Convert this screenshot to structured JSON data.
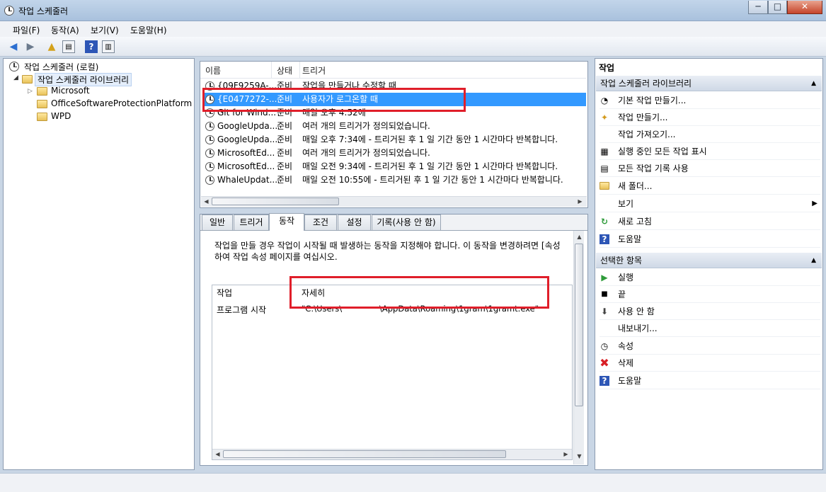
{
  "window": {
    "title": "작업 스케줄러",
    "min": "─",
    "max": "□",
    "close": "✕"
  },
  "menu": [
    "파일(F)",
    "동작(A)",
    "보기(V)",
    "도움말(H)"
  ],
  "tree": {
    "root": "작업 스케줄러 (로컬)",
    "library": "작업 스케줄러 라이브러리",
    "folders": [
      "Microsoft",
      "OfficeSoftwareProtectionPlatform",
      "WPD"
    ]
  },
  "task_table": {
    "columns": [
      "이름",
      "상태",
      "트리거"
    ],
    "rows": [
      {
        "name": "{09F9259A-...",
        "status": "준비",
        "trigger": "작업을 만들거나 수정할 때"
      },
      {
        "name": "{E0477272-...",
        "status": "준비",
        "trigger": "사용자가 로그온할 때"
      },
      {
        "name": "Git for Wind...",
        "status": "준비",
        "trigger": "매일 오후 4:52에"
      },
      {
        "name": "GoogleUpda...",
        "status": "준비",
        "trigger": "여러 개의 트리거가 정의되었습니다."
      },
      {
        "name": "GoogleUpda...",
        "status": "준비",
        "trigger": "매일 오후 7:34에 - 트리거된 후 1 일 기간 동안 1 시간마다 반복합니다."
      },
      {
        "name": "MicrosoftEd...",
        "status": "준비",
        "trigger": "여러 개의 트리거가 정의되었습니다."
      },
      {
        "name": "MicrosoftEd...",
        "status": "준비",
        "trigger": "매일 오전 9:34에 - 트리거된 후 1 일 기간 동안 1 시간마다 반복합니다."
      },
      {
        "name": "WhaleUpdat...",
        "status": "준비",
        "trigger": "매일 오전 10:55에 - 트리거된 후 1 일 기간 동안 1 시간마다 반복합니다."
      }
    ]
  },
  "tabs": [
    "일반",
    "트리거",
    "동작",
    "조건",
    "설정",
    "기록(사용 안 함)"
  ],
  "action_tab": {
    "description_line1": "작업을 만들 경우 작업이 시작될 때 발생하는 동작을 지정해야 합니다. 이 동작을 변경하려면 [속성",
    "description_line2": "하여 작업 속성 페이지를 여십시오.",
    "columns": [
      "작업",
      "자세히"
    ],
    "row": {
      "action": "프로그램 시작",
      "detail_part1": "\"C:\\Users\\",
      "detail_part2": "\\AppData\\Roaming\\1gram\\1gramt.exe\""
    }
  },
  "actions_pane": {
    "header": "작업",
    "section1": "작업 스케줄러 라이브러리",
    "items1": [
      "기본 작업 만들기...",
      "작업 만들기...",
      "작업 가져오기...",
      "실행 중인 모든 작업 표시",
      "모든 작업 기록 사용",
      "새 폴더...",
      "보기",
      "새로 고침",
      "도움말"
    ],
    "section2": "선택한 항목",
    "items2": [
      "실행",
      "끝",
      "사용 안 함",
      "내보내기...",
      "속성",
      "삭제",
      "도움말"
    ]
  },
  "colors": {
    "selection": "#3399ff",
    "highlight_box": "#e01e2a"
  }
}
